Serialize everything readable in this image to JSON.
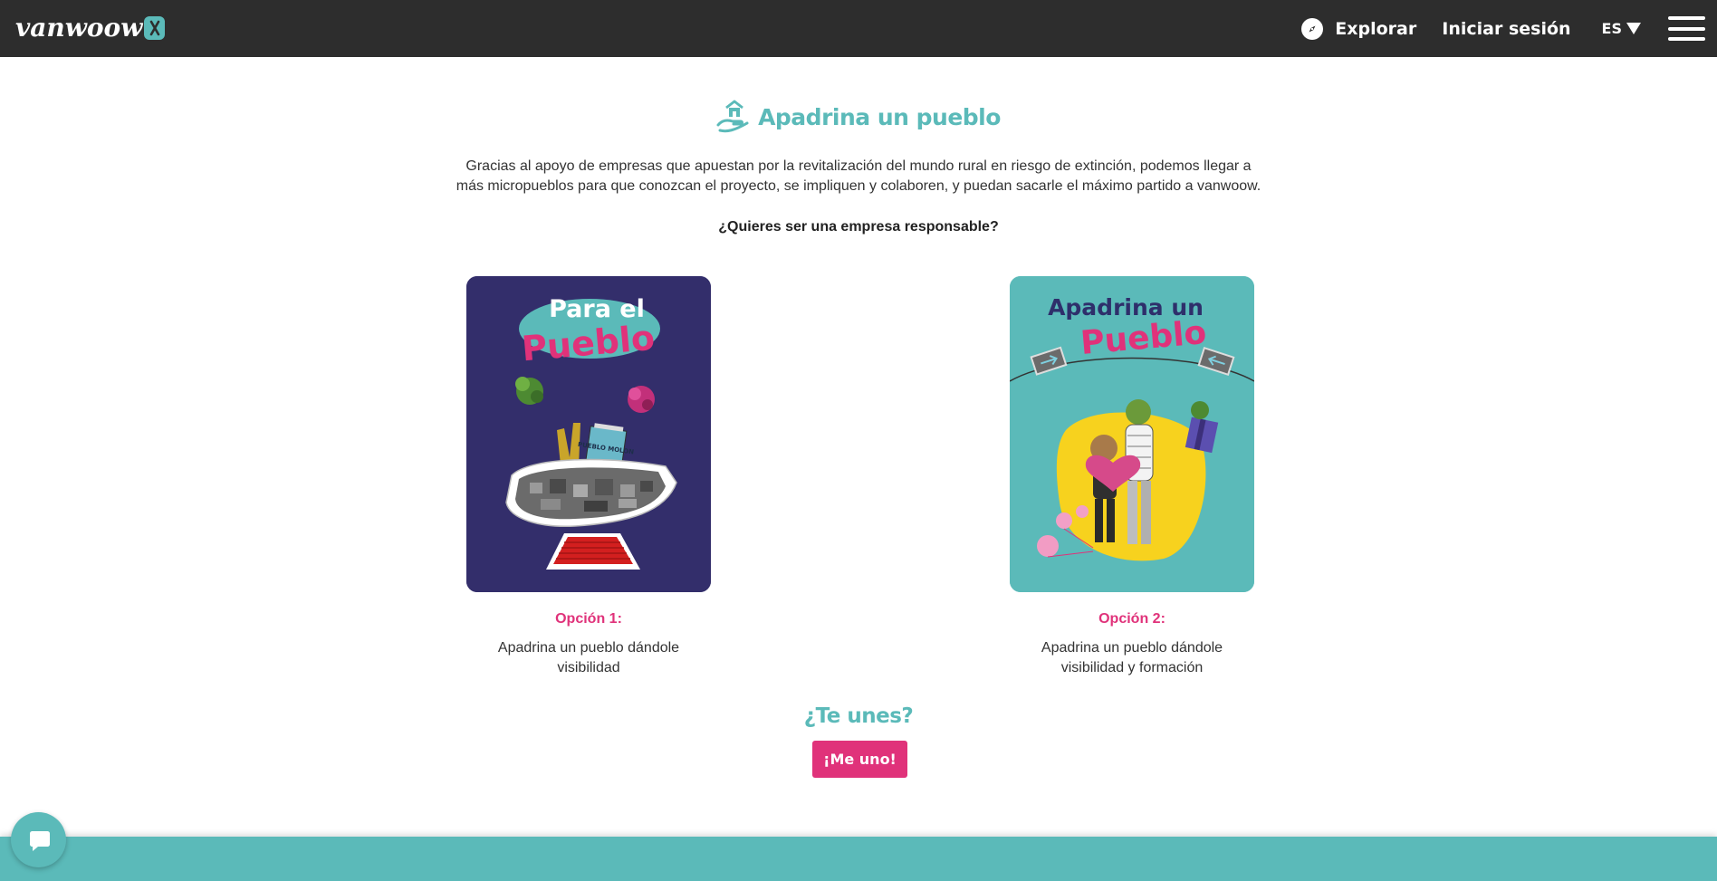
{
  "header": {
    "logo_text": "vanwoow",
    "explore_label": "Explorar",
    "login_label": "Iniciar sesión",
    "language": "ES"
  },
  "section": {
    "title": "Apadrina un pueblo",
    "intro": "Gracias al apoyo de empresas que apuestan por la revitalización del mundo rural en riesgo de extinción, podemos llegar a más micropueblos para que conozcan el proyecto, se impliquen y colaboren, y puedan sacarle el máximo partido a vanwoow.",
    "question": "¿Quieres ser una empresa responsable?"
  },
  "options": [
    {
      "label": "Opción 1:",
      "description": "Apadrina un pueblo dándole visibilidad",
      "poster_line1": "Para el",
      "poster_line2": "Pueblo",
      "poster_sign": "PUEBLO MOLON"
    },
    {
      "label": "Opción 2:",
      "description": "Apadrina un pueblo dándole visibilidad y formación",
      "poster_line1": "Apadrina un",
      "poster_line2": "Pueblo"
    }
  ],
  "cta": {
    "title": "¿Te unes?",
    "button_label": "¡Me uno!"
  },
  "colors": {
    "header_bg": "#2d2d2d",
    "teal": "#5bbab9",
    "pink": "#e0327a",
    "card1_bg": "#332e6b",
    "yellow": "#f7d21e"
  }
}
